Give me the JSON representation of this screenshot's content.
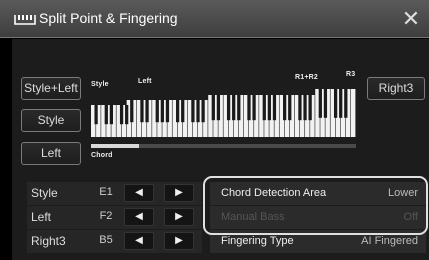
{
  "title": "Split Point & Fingering",
  "close_label": "✕",
  "left_buttons": [
    "Style+Left",
    "Style",
    "Left"
  ],
  "right3_button": "Right3",
  "keyboard_labels": {
    "style": "Style",
    "left": "Left",
    "r1r2": "R1+R2",
    "r3": "R3",
    "chord": "Chord"
  },
  "split_points": [
    {
      "name": "Style",
      "value": "E1",
      "left_arrow": "◀",
      "right_arrow": "▶"
    },
    {
      "name": "Left",
      "value": "F2",
      "left_arrow": "◀",
      "right_arrow": "▶"
    },
    {
      "name": "Right3",
      "value": "B5",
      "left_arrow": "◀",
      "right_arrow": "▶"
    }
  ],
  "chord_settings": [
    {
      "name": "Chord Detection Area",
      "value": "Lower",
      "enabled": true
    },
    {
      "name": "Manual Bass",
      "value": "Off",
      "enabled": false
    },
    {
      "name": "Fingering Type",
      "value": "AI Fingered",
      "enabled": true
    }
  ],
  "colors": {
    "background": "#000000",
    "panel": "#1c1c1c",
    "highlight_border": "#e0e0e0"
  }
}
